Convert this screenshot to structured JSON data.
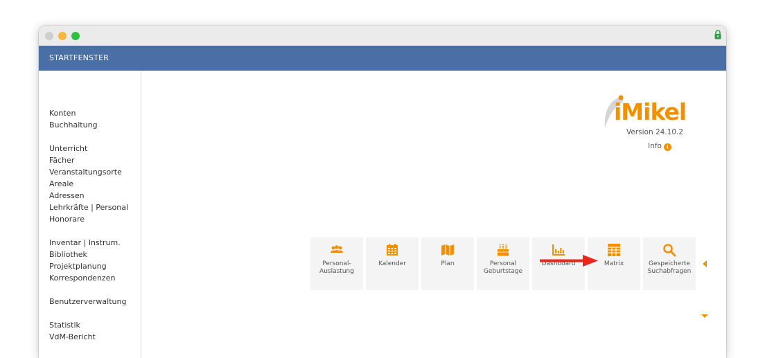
{
  "window": {
    "title_bar": ""
  },
  "header": {
    "title": "STARTFENSTER"
  },
  "sidebar": {
    "groups": [
      [
        "Konten",
        "Buchhaltung"
      ],
      [
        "Unterricht",
        "Fächer",
        "Veranstaltungsorte",
        "Areale",
        "Adressen",
        "Lehrkräfte | Personal",
        "Honorare"
      ],
      [
        "Inventar | Instrum.",
        "Bibliothek",
        "Projektplanung",
        "Korrespondenzen"
      ],
      [
        "Benutzerverwaltung"
      ],
      [
        "Statistik",
        "VdM-Bericht"
      ]
    ]
  },
  "brand": {
    "logo_text": "iMikel",
    "version": "Version 24.10.2",
    "info_label": "Info",
    "info_icon": "info-circle-icon",
    "accent_color": "#f29100",
    "header_color": "#4a6ea6"
  },
  "tiles": [
    {
      "label_line1": "Personal-",
      "label_line2": "Auslastung",
      "icon": "people-icon"
    },
    {
      "label_line1": "Kalender",
      "label_line2": "",
      "icon": "calendar-icon"
    },
    {
      "label_line1": "Plan",
      "label_line2": "",
      "icon": "map-icon"
    },
    {
      "label_line1": "Personal",
      "label_line2": "Geburtstage",
      "icon": "birthday-cake-icon"
    },
    {
      "label_line1": "Dashboard",
      "label_line2": "",
      "icon": "bar-chart-icon"
    },
    {
      "label_line1": "Matrix",
      "label_line2": "",
      "icon": "table-grid-icon"
    },
    {
      "label_line1": "Gespeicherte",
      "label_line2": "Suchabfragen",
      "icon": "search-icon"
    }
  ]
}
